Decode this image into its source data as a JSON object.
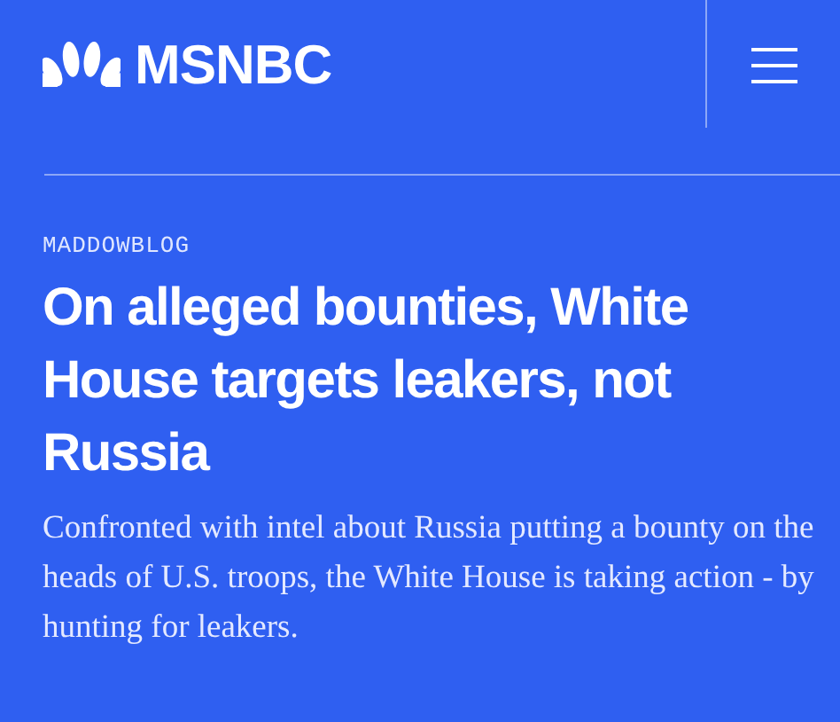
{
  "header": {
    "logo_text": "MSNBC"
  },
  "article": {
    "kicker": "MADDOWBLOG",
    "headline": "On alleged bounties, White House targets leakers, not Russia",
    "summary": "Confronted with intel about Russia putting a bounty on the heads of U.S. troops, the White House is taking action - by hunting for leakers."
  }
}
